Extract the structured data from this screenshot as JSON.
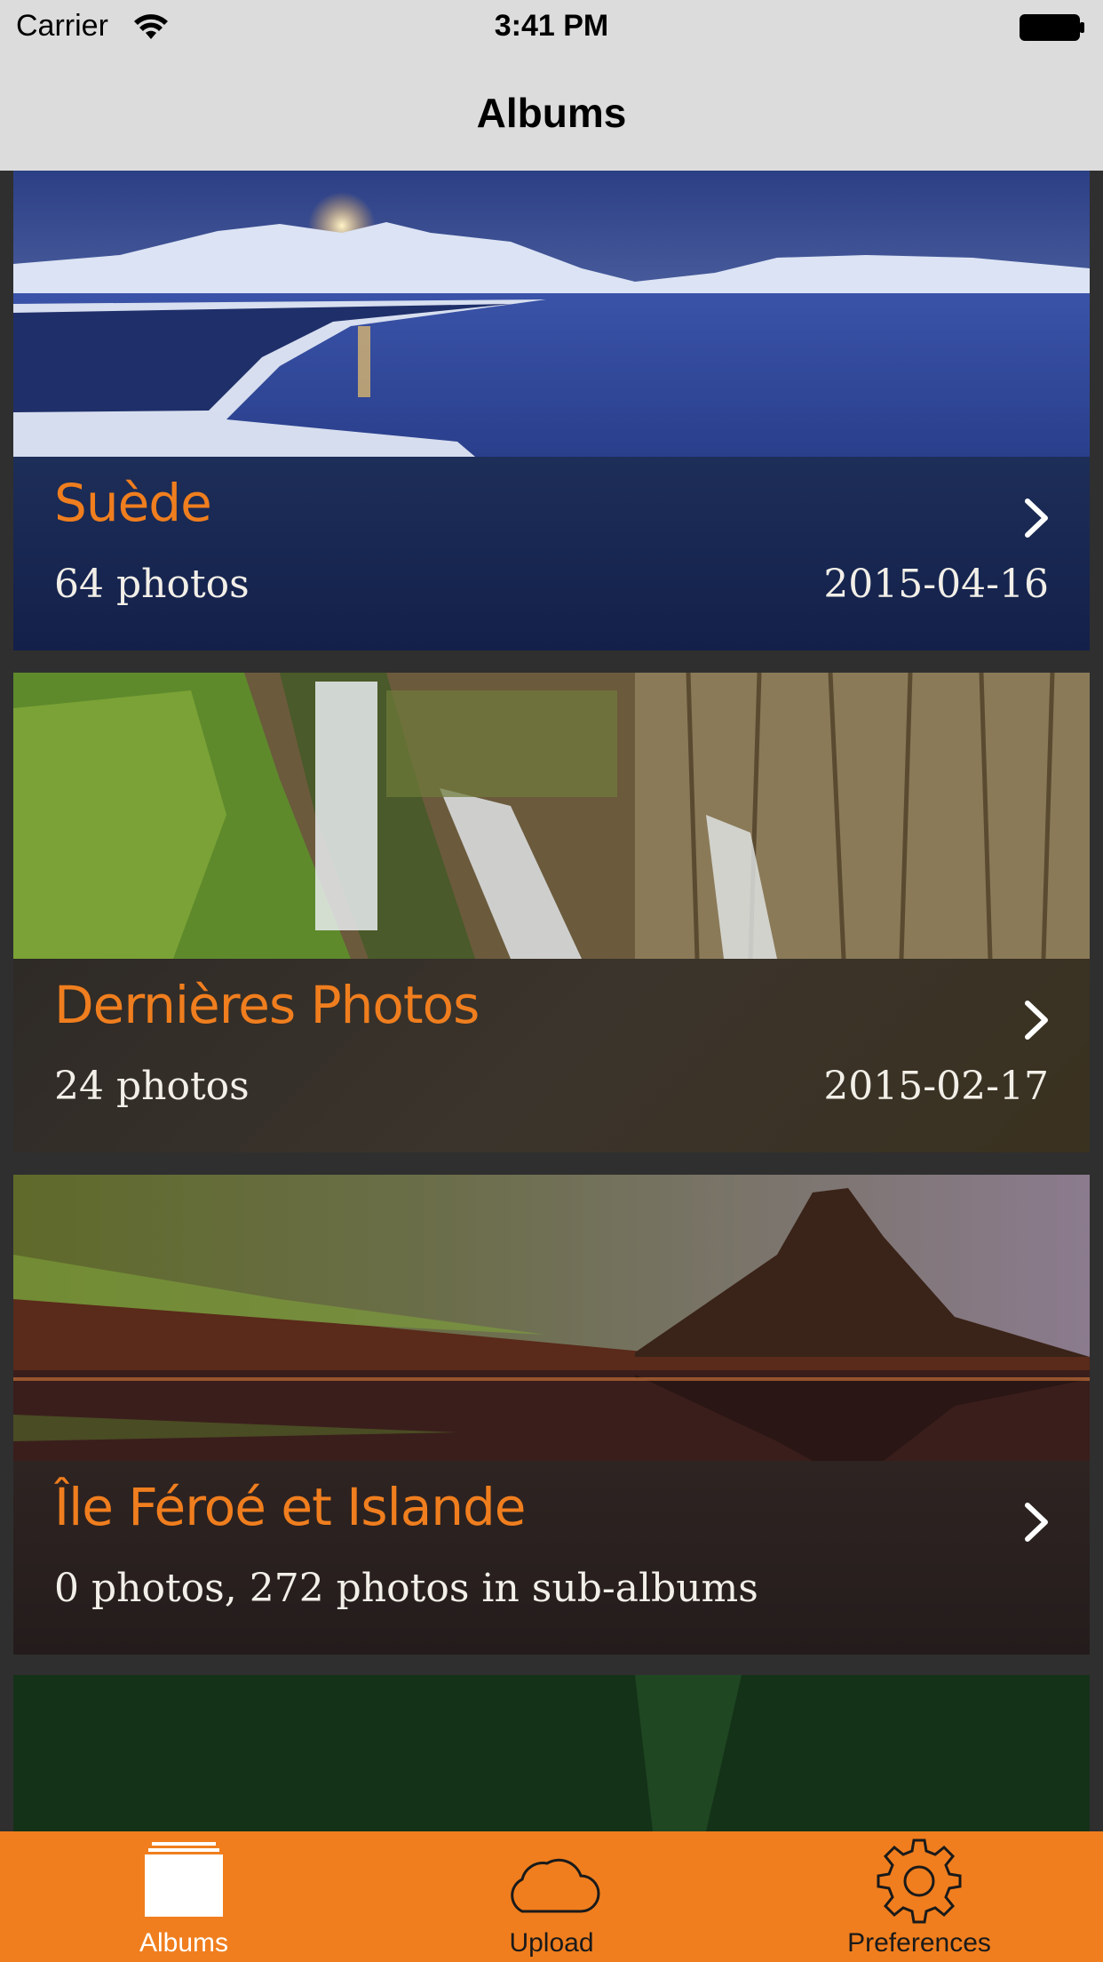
{
  "status_bar": {
    "carrier": "Carrier",
    "time": "3:41 PM"
  },
  "nav": {
    "title": "Albums"
  },
  "albums": [
    {
      "title": "Suède",
      "count": "64 photos",
      "date": "2015-04-16"
    },
    {
      "title": "Dernières Photos",
      "count": "24 photos",
      "date": "2015-02-17"
    },
    {
      "title": "Île Féroé et Islande",
      "count": "0 photos, 272 photos in sub-albums",
      "date": ""
    }
  ],
  "tab_bar": {
    "items": [
      {
        "label": "Albums",
        "icon": "albums-icon",
        "active": true
      },
      {
        "label": "Upload",
        "icon": "cloud-upload-icon",
        "active": false
      },
      {
        "label": "Preferences",
        "icon": "gear-icon",
        "active": false
      }
    ]
  },
  "colors": {
    "accent": "#f07e1e",
    "nav_bg": "#dcdcdc",
    "list_bg": "#2f2f2f",
    "text_light": "#f2efe8"
  }
}
